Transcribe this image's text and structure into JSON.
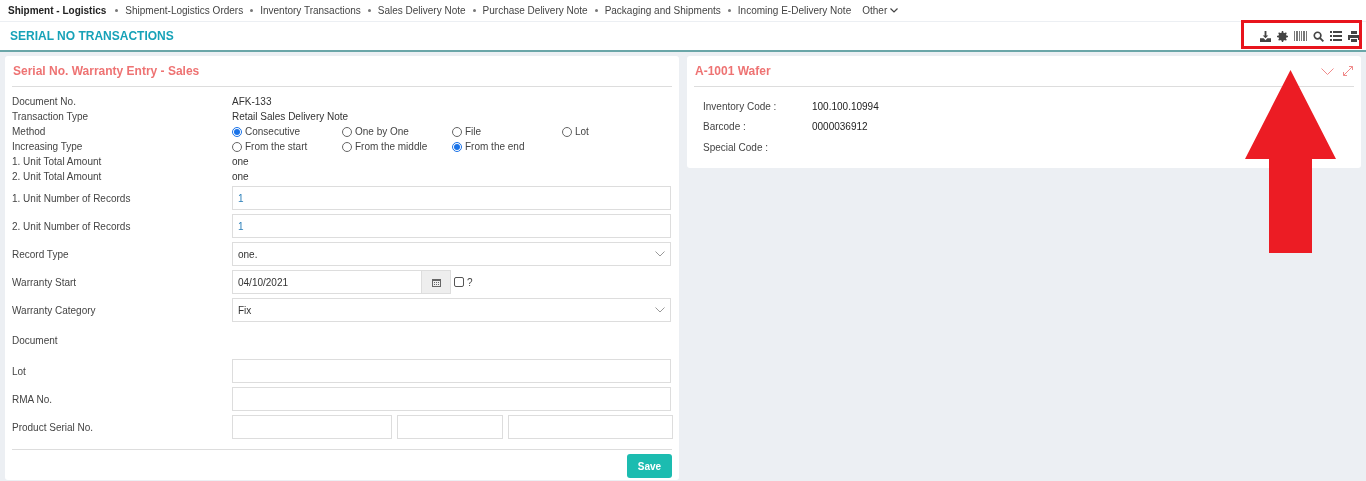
{
  "nav": {
    "items": [
      {
        "label": "Shipment - Logistics",
        "selected": true
      },
      {
        "label": "Shipment-Logistics Orders",
        "selected": false
      },
      {
        "label": "Inventory Transactions",
        "selected": false
      },
      {
        "label": "Sales Delivery Note",
        "selected": false
      },
      {
        "label": "Purchase Delivery Note",
        "selected": false
      },
      {
        "label": "Packaging and Shipments",
        "selected": false
      },
      {
        "label": "Incoming E-Delivery Note",
        "selected": false
      }
    ],
    "more": "Other"
  },
  "page_title": "SERIAL NO TRANSACTIONS",
  "form": {
    "title": "Serial No. Warranty Entry - Sales",
    "rows": [
      {
        "kind": "text",
        "label": "Document No.",
        "value": "AFK-133"
      },
      {
        "kind": "text",
        "label": "Transaction Type",
        "value": "Retail Sales Delivery Note"
      },
      {
        "kind": "radio",
        "label": "Method",
        "options": [
          {
            "label": "Consecutive",
            "selected": true
          },
          {
            "label": "One by One",
            "selected": false
          },
          {
            "label": "File",
            "selected": false
          },
          {
            "label": "Lot",
            "selected": false
          }
        ]
      },
      {
        "kind": "radio",
        "label": "Increasing Type",
        "options": [
          {
            "label": "From the start",
            "selected": false
          },
          {
            "label": "From the middle",
            "selected": false
          },
          {
            "label": "From the end",
            "selected": true
          }
        ]
      },
      {
        "kind": "text",
        "label": "1. Unit Total Amount",
        "value": "one"
      },
      {
        "kind": "text",
        "label": "2. Unit Total Amount",
        "value": "one"
      },
      {
        "kind": "input",
        "label": "1. Unit Number of Records",
        "value": "1"
      },
      {
        "kind": "input",
        "label": "2. Unit Number of Records",
        "value": "1"
      },
      {
        "kind": "select",
        "label": "Record Type",
        "value": "one."
      },
      {
        "kind": "date",
        "label": "Warranty Start",
        "value": "04/10/2021",
        "checkbox": {
          "label": "?",
          "checked": false
        }
      },
      {
        "kind": "select",
        "label": "Warranty Category",
        "value": "Fix"
      },
      {
        "kind": "label",
        "label": "Document"
      },
      {
        "kind": "input",
        "label": "Lot"
      },
      {
        "kind": "input",
        "label": "RMA No."
      },
      {
        "kind": "triple",
        "label": "Product Serial No."
      }
    ],
    "save": "Save"
  },
  "item": {
    "title": "A-1001 Wafer",
    "fields": [
      {
        "label": "Inventory Code :",
        "value": "100.100.10994"
      },
      {
        "label": "Barcode :",
        "value": "0000036912"
      },
      {
        "label": "Special Code :"
      }
    ]
  }
}
